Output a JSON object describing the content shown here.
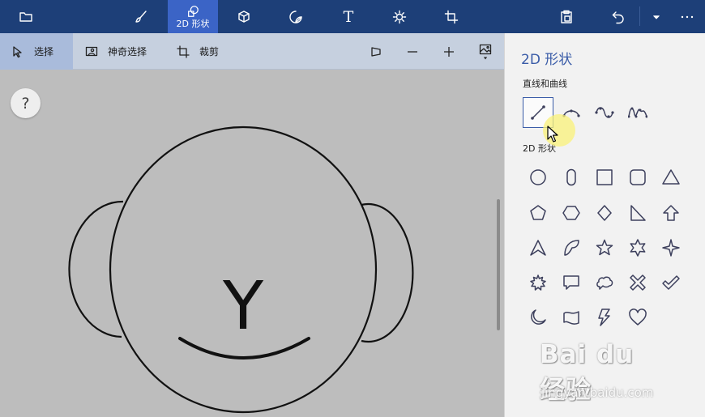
{
  "toolbar": {
    "tab_2d_label": "2D 形状",
    "text_tool_glyph": "T",
    "icons": [
      "folder-icon",
      "brush-icon",
      "2d-shapes-icon",
      "3d-shapes-icon",
      "sticker-icon",
      "text-icon",
      "effects-icon",
      "canvas-icon",
      "paste-icon",
      "undo-icon",
      "chevron-down-icon",
      "more-icon"
    ]
  },
  "subbar": {
    "select_label": "选择",
    "magic_select_label": "神奇选择",
    "crop_label": "裁剪"
  },
  "canvas": {
    "help_label": "?",
    "letter": "Y"
  },
  "panel": {
    "title": "2D 形状",
    "lines_label": "直线和曲线",
    "shapes_label": "2D 形状",
    "line_tools": [
      "line-icon",
      "curve-icon",
      "s-curve-icon",
      "wave-curve-icon"
    ],
    "shape_tools": [
      [
        "circle-icon",
        "capsule-icon",
        "square-icon",
        "rounded-square-icon",
        "triangle-icon"
      ],
      [
        "pentagon-icon",
        "hexagon-icon",
        "diamond-icon",
        "right-triangle-icon",
        "arrow-up-icon"
      ],
      [
        "arrowhead-icon",
        "petal-icon",
        "star5-icon",
        "star6-icon",
        "star4-icon"
      ],
      [
        "burst-icon",
        "speech-bubble-icon",
        "thought-bubble-icon",
        "x-icon",
        "check-icon"
      ],
      [
        "moon-icon",
        "banner-icon",
        "lightning-icon",
        "heart-icon"
      ]
    ]
  },
  "colors": {
    "topbar_bg": "#1d3f78",
    "active_tab_bg": "#3b64c6",
    "accent": "#3a5ca8",
    "canvas_bg": "#bdbdbd",
    "panel_bg": "#f2f2f2"
  },
  "watermark": {
    "main": "Bai du 经验",
    "sub": "jingyan.baidu.com"
  }
}
